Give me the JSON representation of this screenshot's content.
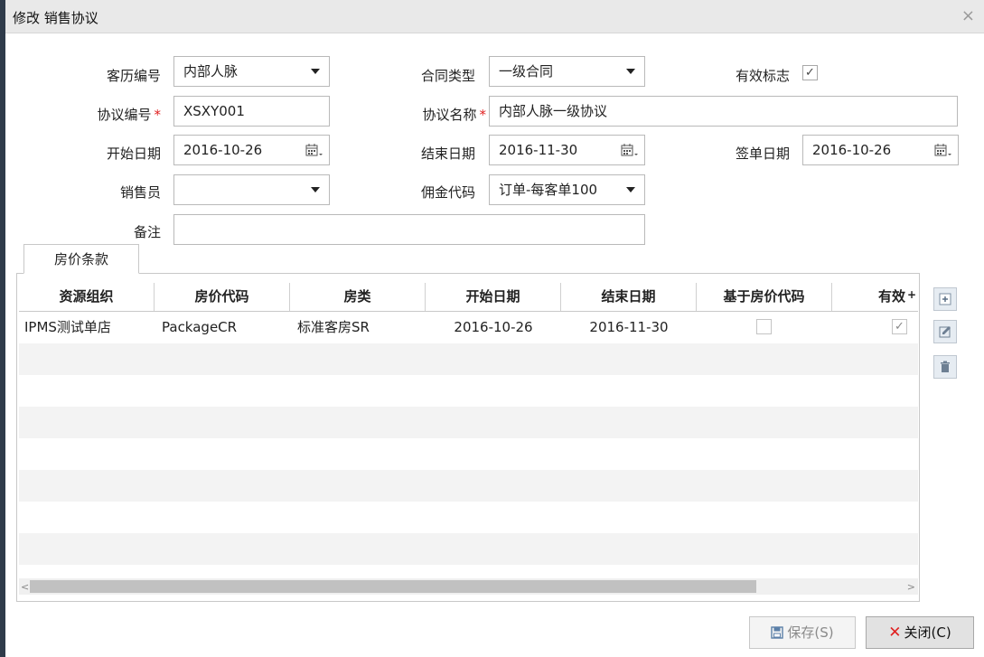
{
  "window": {
    "title": "修改 销售协议",
    "close_glyph": "×"
  },
  "form": {
    "customer_no_label": "客历编号",
    "customer_no_value": "内部人脉",
    "contract_type_label": "合同类型",
    "contract_type_value": "一级合同",
    "valid_flag_label": "有效标志",
    "valid_flag_checked": true,
    "agreement_no_label": "协议编号",
    "agreement_no_value": "XSXY001",
    "agreement_name_label": "协议名称",
    "agreement_name_value": "内部人脉一级协议",
    "required_mark": "*",
    "start_date_label": "开始日期",
    "start_date_value": "2016-10-26",
    "end_date_label": "结束日期",
    "end_date_value": "2016-11-30",
    "sign_date_label": "签单日期",
    "sign_date_value": "2016-10-26",
    "sales_label": "销售员",
    "sales_value": "",
    "commission_label": "佣金代码",
    "commission_value": "订单-每客单100",
    "remark_label": "备注",
    "remark_value": ""
  },
  "tabs": [
    {
      "label": "房价条款"
    }
  ],
  "grid": {
    "columns": [
      "资源组织",
      "房价代码",
      "房类",
      "开始日期",
      "结束日期",
      "基于房价代码",
      "有效"
    ],
    "sort_glyph": "+",
    "rows": [
      {
        "org": "IPMS测试单店",
        "rate_code": "PackageCR",
        "room_type": "标准客房SR",
        "start": "2016-10-26",
        "end": "2016-11-30",
        "based_on_rate": false,
        "valid": true
      }
    ]
  },
  "icons": {
    "add": "plus-square-icon",
    "edit": "edit-icon",
    "delete": "trash-icon",
    "calendar": "calendar-icon"
  },
  "buttons": {
    "save_label": "保存(S)",
    "close_label": "关闭(C)"
  },
  "colors": {
    "window_title_bg": "#e9e9e9",
    "close_x": "#e02020",
    "row_alt": "#f3f3f3"
  }
}
